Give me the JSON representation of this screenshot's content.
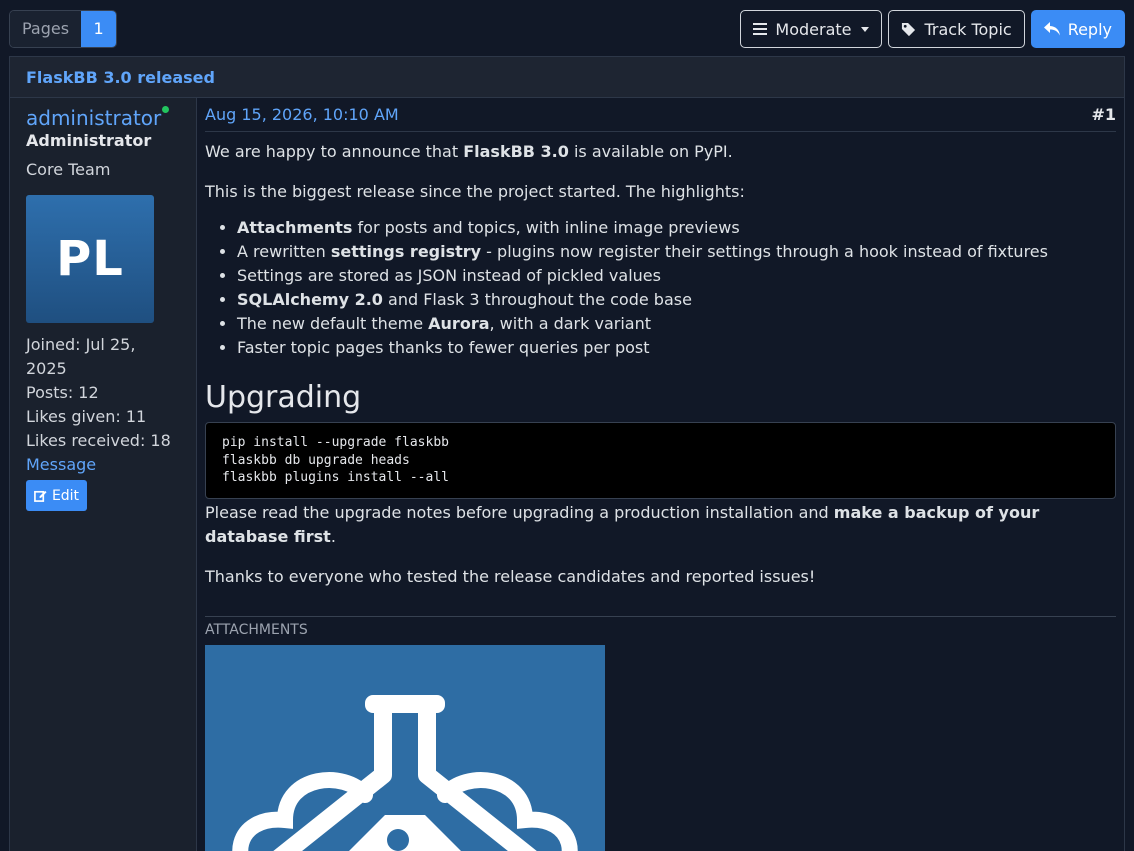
{
  "pager": {
    "label": "Pages",
    "current": "1"
  },
  "actions": {
    "moderate": "Moderate",
    "track": "Track Topic",
    "reply": "Reply"
  },
  "topic": {
    "title": "FlaskBB 3.0 released"
  },
  "author": {
    "username": "administrator",
    "role": "Administrator",
    "team": "Core Team",
    "avatar_initials": "PL",
    "joined": "Joined: Jul 25, 2025",
    "posts": "Posts: 12",
    "likes_given": "Likes given: 11",
    "likes_received": "Likes received: 18",
    "message_link": "Message",
    "edit_label": "Edit"
  },
  "post": {
    "date": "Aug 15, 2026, 10:10 AM",
    "number": "#1",
    "p1_a": "We are happy to announce that ",
    "p1_b": "FlaskBB 3.0",
    "p1_c": " is available on PyPI.",
    "p2": "This is the biggest release since the project started. The highlights:",
    "list": [
      {
        "bold": "Attachments",
        "rest": " for posts and topics, with inline image previews",
        "pre": ""
      },
      {
        "pre": "A rewritten ",
        "bold": "settings registry",
        "rest": " - plugins now register their settings through a hook instead of fixtures"
      },
      {
        "pre": "Settings are stored as JSON instead of pickled values",
        "bold": "",
        "rest": ""
      },
      {
        "pre": "",
        "bold": "SQLAlchemy 2.0",
        "rest": " and Flask 3 throughout the code base"
      },
      {
        "pre": "The new default theme ",
        "bold": "Aurora",
        "rest": ", with a dark variant"
      },
      {
        "pre": "Faster topic pages thanks to fewer queries per post",
        "bold": "",
        "rest": ""
      }
    ],
    "heading": "Upgrading",
    "code": "pip install --upgrade flaskbb\nflaskbb db upgrade heads\nflaskbb plugins install --all",
    "p3_a": "Please read the upgrade notes before upgrading a production installation and ",
    "p3_b": "make a backup of your database first",
    "p3_c": ".",
    "p4": "Thanks to everyone who tested the release candidates and reported issues!",
    "attachments_label": "ATTACHMENTS"
  },
  "colors": {
    "accent": "#3b8cf5",
    "link": "#60a5fa",
    "online": "#22c55e",
    "background": "#111827"
  }
}
